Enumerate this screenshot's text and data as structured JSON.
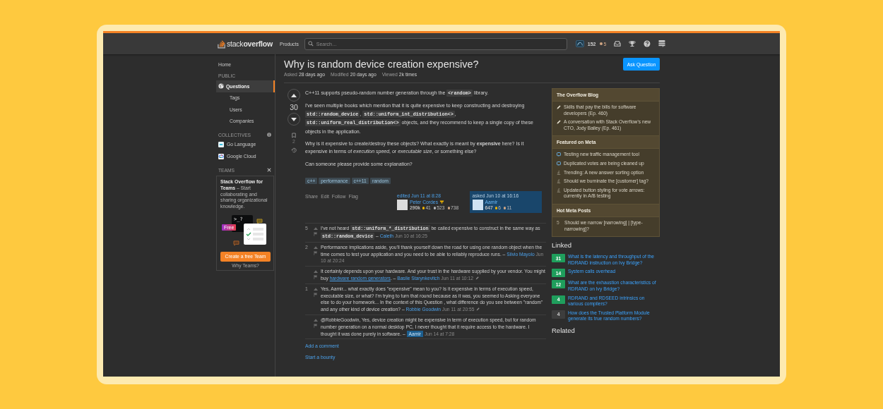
{
  "top_bar": {
    "logo": "stack**overflow**",
    "products": "Products",
    "search": {
      "placeholder": "Search…"
    },
    "reputation": "152",
    "badges": [
      {
        "color": "#d1a684",
        "count": "5"
      }
    ]
  },
  "sidebar": {
    "home": {
      "label": "Home",
      "selected": false
    },
    "public_heading": "PUBLIC",
    "items": [
      {
        "label": "Questions",
        "selected": true,
        "kind": "globe"
      },
      {
        "label": "Tags",
        "selected": false,
        "kind": "plain"
      },
      {
        "label": "Users",
        "selected": false,
        "kind": "plain"
      },
      {
        "label": "Companies",
        "selected": false,
        "kind": "plain"
      }
    ],
    "collectives_heading": "COLLECTIVES",
    "collectives": [
      {
        "label": "Go Language",
        "kind": "go"
      },
      {
        "label": "Google Cloud",
        "kind": "cloud"
      }
    ],
    "teams_heading": "TEAMS",
    "teams_card": {
      "text": "**Stack Overflow for Teams** – Start collaborating and sharing organizational knowledge.",
      "prompt": ">_?",
      "free": "Free",
      "button": "Create a free Team",
      "link": "Why Teams?"
    }
  },
  "question": {
    "title": "Why is random device creation expensive?",
    "ask_button": "Ask Question",
    "meta": [
      {
        "label": "Asked",
        "value": "28 days ago"
      },
      {
        "label": "Modified",
        "value": "20 days ago"
      },
      {
        "label": "Viewed",
        "value": "2k times"
      }
    ]
  },
  "post": {
    "score": "30",
    "bookmarks": "2",
    "paragraphs": [
      {
        "parts": [
          {
            "kind": "text",
            "text": "C++11 supports pseudo-random number generation through the "
          },
          {
            "kind": "code",
            "text": "<random>"
          },
          {
            "kind": "text",
            "text": " library."
          }
        ]
      },
      {
        "parts": [
          {
            "kind": "text",
            "text": "I've seen multiple books which mention that it is quite expensive to keep constructing and destroying "
          },
          {
            "kind": "code",
            "text": "std::random_device"
          },
          {
            "kind": "text",
            "text": ", "
          },
          {
            "kind": "code",
            "text": "std::uniform_int_distribution<>"
          },
          {
            "kind": "text",
            "text": ", "
          },
          {
            "kind": "code",
            "text": "std::uniform_real_distribution<>"
          },
          {
            "kind": "text",
            "text": " objects, and they recommend to keep a single copy of these objects in the application."
          }
        ]
      },
      {
        "parts": [
          {
            "kind": "text",
            "text": "Why is it expensive to create/destroy these objects? What exactly is meant by **expensive** here? Is it expensive in terms of *execution speed*, or *executable size*, or something else?"
          }
        ]
      },
      {
        "parts": [
          {
            "kind": "text",
            "text": "Can someone please provide some explanation?"
          }
        ]
      }
    ],
    "tags": [
      "c++",
      "performance",
      "c++11",
      "random"
    ],
    "actions": [
      "Share",
      "Edit",
      "Follow",
      "Flag"
    ],
    "signatures": [
      {
        "action": "edited Jun 11 at 8:28",
        "name": "Peter Cordes",
        "tag_badge": true,
        "highlighted": false,
        "reputation": "290k",
        "badges": [
          {
            "color": "#f1b600",
            "count": "41"
          },
          {
            "color": "#b4b8bc",
            "count": "523"
          },
          {
            "color": "#d1a684",
            "count": "738"
          }
        ]
      },
      {
        "action": "asked Jun 10 at 16:16",
        "name": "Aamir",
        "tag_badge": false,
        "highlighted": true,
        "reputation": "647",
        "badges": [
          {
            "color": "#f1b600",
            "count": "6"
          },
          {
            "color": "#d1a684",
            "count": "11"
          }
        ]
      }
    ]
  },
  "comments": [
    {
      "score": "5",
      "parts": [
        {
          "kind": "text",
          "text": "I've not heard "
        },
        {
          "kind": "code",
          "text": "std::uniform_*_distribution"
        },
        {
          "kind": "text",
          "text": " be called expensive to construct in the same way as "
        },
        {
          "kind": "code",
          "text": "std::random_device"
        },
        {
          "kind": "text",
          "text": " –"
        }
      ],
      "author": "Caleth",
      "op": false,
      "date": "Jun 10 at 16:25",
      "edited": false
    },
    {
      "score": "2",
      "parts": [
        {
          "kind": "text",
          "text": "Performance implications aside, you'll thank yourself down the road for using one random object when the time comes to test your application and you need to be able to reliably reproduce runs. –"
        }
      ],
      "author": "Silvio Mayolo",
      "op": false,
      "date": "Jun 10 at 20:24",
      "edited": false
    },
    {
      "parts": [
        {
          "kind": "text",
          "text": "It certainly depends upon your hardware. And your trust in the hardware supplied by your vendor. You might buy "
        },
        {
          "kind": "link",
          "text": "hardware random generators"
        },
        {
          "kind": "text",
          "text": ". –"
        }
      ],
      "author": "Basile Starynkevitch",
      "op": false,
      "date": "Jun 11 at 10:12",
      "edited": true
    },
    {
      "score": "1",
      "parts": [
        {
          "kind": "text",
          "text": "Yes, Aamir... what exactly does \"expensive\" mean to you? Is it expensive in terms of execution speed, executable size, or what? I'm trying to turn that round because as it was, you seemed to Asking everyone else to do your homework... In the context of this Question , what difference do you see between \"random\" and any other kind of device creation? –"
        }
      ],
      "author": "Robbie Goodwin",
      "op": false,
      "date": "Jun 11 at 20:55",
      "edited": true
    },
    {
      "parts": [
        {
          "kind": "text",
          "text": "@RobbieGoodwin, Yes, device creation might be expensive in term of execution speed, but for random number generation on a normal desktop PC, I never thought that it require access to the hardware. I thought it was done purely in software. –"
        }
      ],
      "author": "Aamir",
      "op": true,
      "date": "Jun 14 at 7:28",
      "edited": false
    }
  ],
  "add_comment": "Add a comment",
  "start_bounty": "Start a bounty",
  "blog": [
    {
      "title": "The Overflow Blog",
      "items": [
        {
          "kind": "blog",
          "text": "Skills that pay the bills for software developers (Ep. 460)"
        },
        {
          "kind": "blog",
          "text": "A conversation with Stack Overflow's new CTO, Jody Bailey (Ep. 461)"
        }
      ]
    },
    {
      "title": "Featured on Meta",
      "items": [
        {
          "kind": "announcement",
          "text": "Testing new traffic management tool"
        },
        {
          "kind": "announcement",
          "text": "Duplicated votes are being cleaned up"
        },
        {
          "kind": "meta",
          "text": "Trending: A new answer sorting option"
        },
        {
          "kind": "meta",
          "text": "Should we burninate the [customer] tag?"
        },
        {
          "kind": "meta",
          "text": "Updated button styling for vote arrows: currently in A/B testing"
        }
      ]
    },
    {
      "title": "Hot Meta Posts",
      "items": [
        {
          "kind": "count",
          "count": "5",
          "text": "Should we narrow [narrowing] | [type-narrowing]?"
        }
      ]
    }
  ],
  "linked": {
    "heading": "Linked",
    "items": [
      {
        "count": "31",
        "accepted": true,
        "title": "What is the latency and throughput of the RDRAND instruction on Ivy Bridge?"
      },
      {
        "count": "14",
        "accepted": true,
        "title": "System calls overhead"
      },
      {
        "count": "12",
        "accepted": true,
        "title": "What are the exhaustion characteristics of RDRAND on Ivy Bridge?"
      },
      {
        "count": "4",
        "accepted": true,
        "title": "RDRAND and RDSEED intrinsics on various compilers?"
      },
      {
        "count": "4",
        "accepted": false,
        "title": "How does the Trusted Platform Module generate its true random numbers?"
      }
    ]
  },
  "related": {
    "heading": "Related"
  }
}
